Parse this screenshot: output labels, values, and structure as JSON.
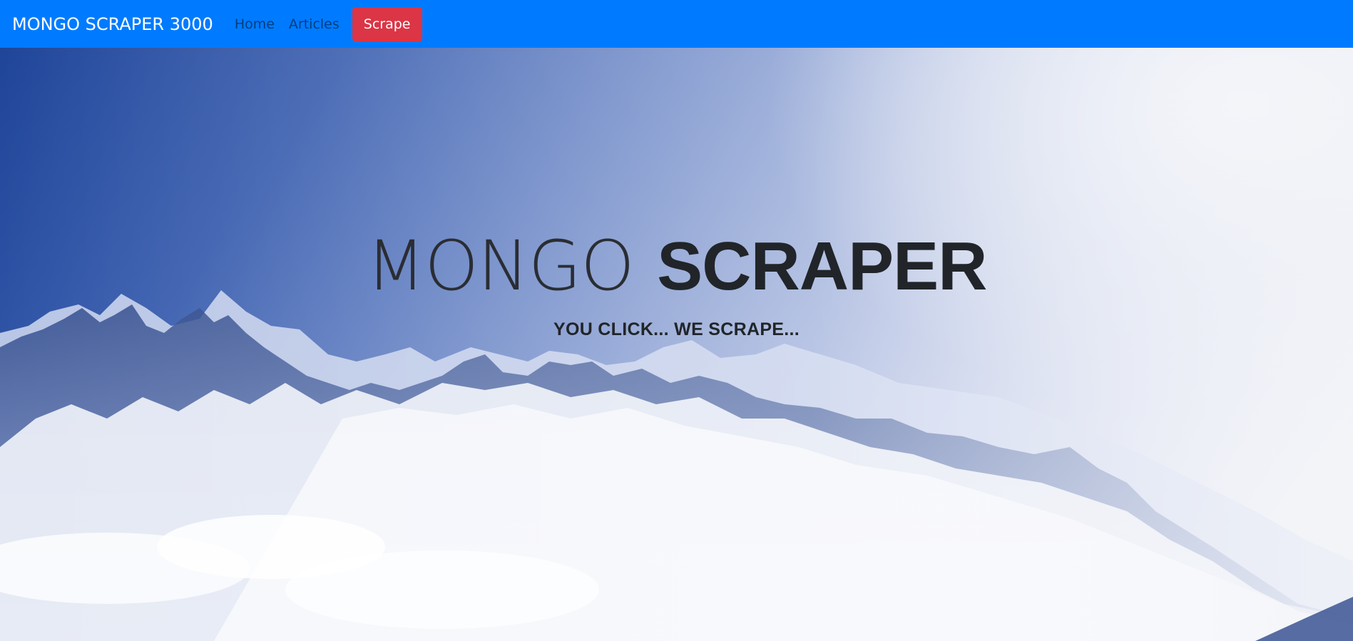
{
  "navbar": {
    "brand": "MONGO SCRAPER 3000",
    "links": [
      {
        "label": "Home"
      },
      {
        "label": "Articles"
      }
    ],
    "scrape_button": "Scrape",
    "colors": {
      "background": "#007bff",
      "button": "#dc3545"
    }
  },
  "hero": {
    "title_light": "MONGO",
    "title_bold": "SCRAPER",
    "subtitle": "YOU CLICK... WE SCRAPE...",
    "background": "snowy-mountains-image"
  }
}
